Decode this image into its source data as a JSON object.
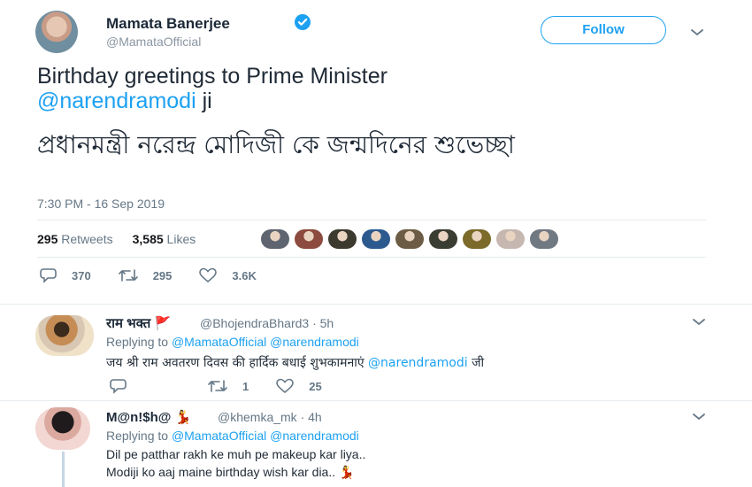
{
  "tweet": {
    "author_name": "Mamata Banerjee",
    "author_handle": "@MamataOfficial",
    "follow_label": "Follow",
    "text_prefix": "Birthday greetings to Prime Minister",
    "text_mention": "@narendramodi",
    "text_suffix": " ji",
    "bengali_text": "প্রধানমন্ত্রী নরেন্দ্র মোদিজী কে জন্মদিনের শুভেচ্ছা",
    "timestamp": "7:30 PM - 16 Sep 2019",
    "retweets_count": "295",
    "retweets_label": "Retweets",
    "likes_count": "3,585",
    "likes_label": "Likes",
    "actions": {
      "replies": "370",
      "retweets": "295",
      "likes": "3.6K"
    },
    "liker_colors": [
      "#5e6470",
      "#8c4b3e",
      "#3c3a2f",
      "#2d5a8e",
      "#6d5c45",
      "#3a3d32",
      "#7b6a2a",
      "#c6b7b0",
      "#707982"
    ]
  },
  "replies": [
    {
      "name": "राम भक्त",
      "flag": "🚩",
      "handle": "@BhojendraBhard3",
      "time": "5h",
      "replying_to": "Replying to",
      "reply_mentions": [
        "@MamataOfficial",
        "@narendramodi"
      ],
      "body_prefix": "जय श्री राम अवतरण दिवस की हार्दिक बधाई शुभकामनाएं",
      "body_mention": "@narendramodi",
      "body_suffix": "जी",
      "actions": {
        "replies": "",
        "retweets": "1",
        "likes": "25"
      }
    },
    {
      "name": "M@n!$h@",
      "emoji": "💃",
      "handle": "@khemka_mk",
      "time": "4h",
      "replying_to": "Replying to",
      "reply_mentions": [
        "@MamataOfficial",
        "@narendramodi"
      ],
      "body_line1": "Dil pe patthar rakh ke muh pe makeup kar liya..",
      "body_line2": "Modiji ko aaj maine birthday wish kar dia..",
      "body_line2_emoji": "💃"
    }
  ],
  "colors": {
    "accent": "#1da1f2",
    "muted": "#657786",
    "divider": "#e6ecf0"
  },
  "icons": {
    "verified": "verified-badge-icon",
    "reply": "reply-icon",
    "retweet": "retweet-icon",
    "like": "heart-icon",
    "more": "chevron-down-icon"
  }
}
